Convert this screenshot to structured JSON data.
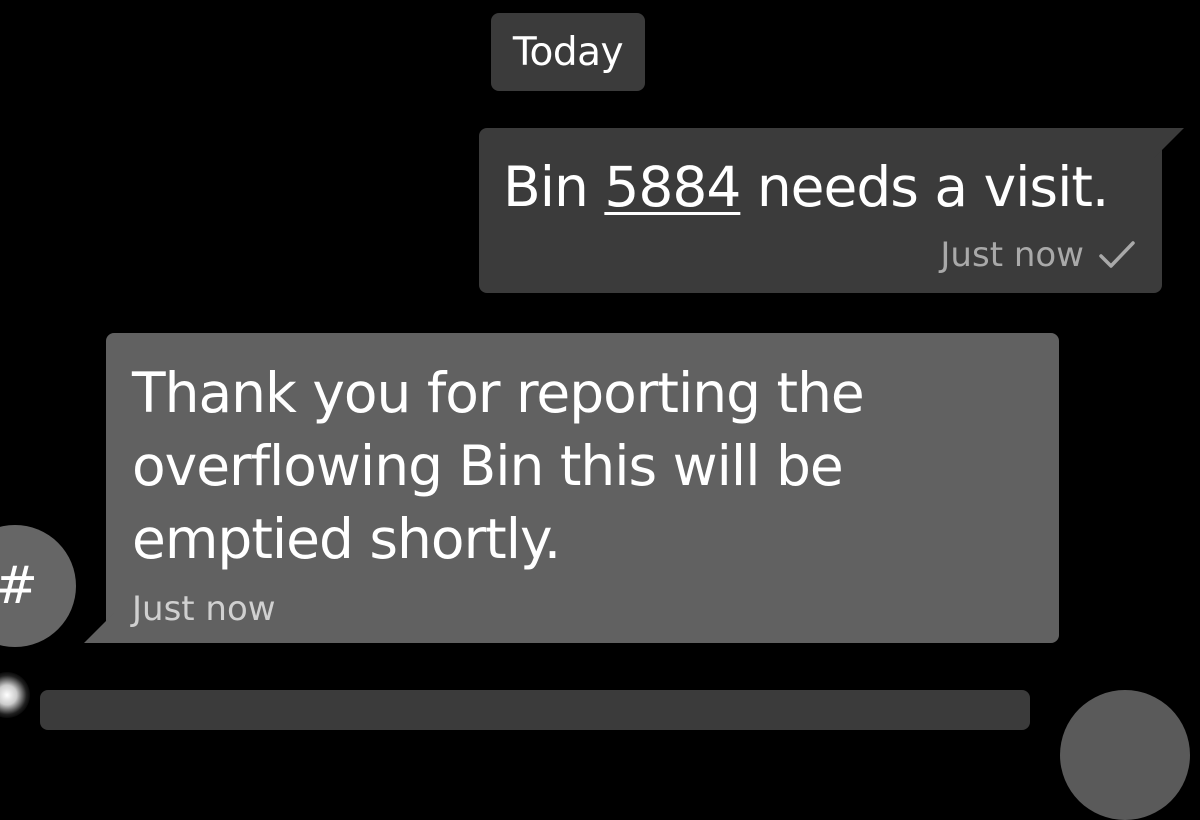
{
  "date_separator": "Today",
  "outgoing_message": {
    "text_before": "Bin ",
    "link": "5884",
    "text_after": " needs a visit.",
    "timestamp": "Just now",
    "status_icon": "check-icon"
  },
  "incoming_message": {
    "text": "Thank you for reporting the overflowing Bin this will be emptied shortly.",
    "timestamp": "Just now",
    "avatar_label": "#"
  },
  "colors": {
    "background": "#000000",
    "outgoing_bubble": "#3b3b3b",
    "incoming_bubble": "#616161",
    "timestamp": "#a9a9a9"
  }
}
